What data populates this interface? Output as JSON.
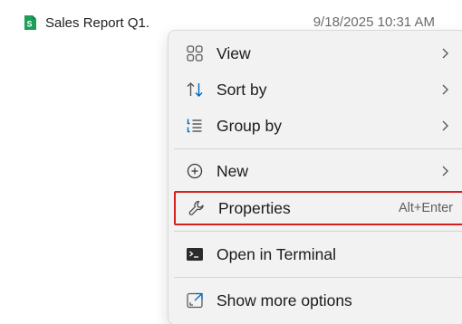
{
  "file": {
    "name": "Sales Report Q1.",
    "date": "9/18/2025 10:31 AM",
    "icon": "spreadsheet-file-icon",
    "icon_letter": "S",
    "icon_color": "#1e9e5a"
  },
  "menu": {
    "items": [
      {
        "label": "View",
        "icon": "view-grid-icon",
        "submenu": true
      },
      {
        "label": "Sort by",
        "icon": "sort-icon",
        "submenu": true
      },
      {
        "label": "Group by",
        "icon": "group-list-icon",
        "submenu": true
      },
      {
        "label": "New",
        "icon": "new-plus-icon",
        "submenu": true
      },
      {
        "label": "Properties",
        "icon": "wrench-icon",
        "shortcut": "Alt+Enter",
        "highlighted": true
      },
      {
        "label": "Open in Terminal",
        "icon": "terminal-icon"
      },
      {
        "label": "Show more options",
        "icon": "more-options-icon"
      }
    ],
    "accent_color": "#0067c0",
    "highlight_border_color": "#d61f1f"
  }
}
